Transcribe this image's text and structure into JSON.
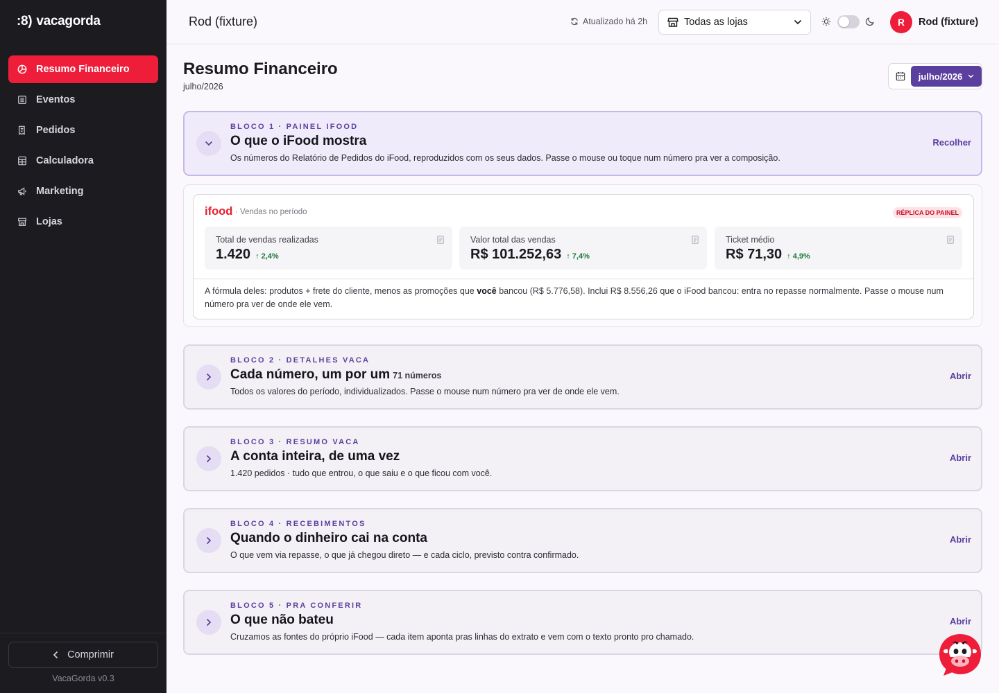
{
  "sidebar": {
    "logo_mark": ":8)",
    "logo_text": "vacagorda",
    "items": [
      {
        "label": "Resumo Financeiro",
        "icon": "pie-chart-icon",
        "active": true
      },
      {
        "label": "Eventos",
        "icon": "list-icon"
      },
      {
        "label": "Pedidos",
        "icon": "receipt-icon"
      },
      {
        "label": "Calculadora",
        "icon": "calculator-icon"
      },
      {
        "label": "Marketing",
        "icon": "megaphone-icon"
      },
      {
        "label": "Lojas",
        "icon": "store-icon"
      }
    ],
    "collapse_label": "Comprimir",
    "version": "VacaGorda v0.3"
  },
  "topbar": {
    "title": "Rod (fixture)",
    "updated": "Atualizado há 2h",
    "store_select": "Todas as lojas",
    "user_initial": "R",
    "user_name": "Rod (fixture)"
  },
  "page": {
    "title": "Resumo Financeiro",
    "subtitle": "julho/2026",
    "period": "julho/2026"
  },
  "blocks": [
    {
      "eyebrow": "BLOCO 1 · PAINEL IFOOD",
      "title": "O que o iFood mostra",
      "count": "",
      "desc": "Os números do Relatório de Pedidos do iFood, reproduzidos com os seus dados. Passe o mouse ou toque num número pra ver a composição.",
      "action": "Recolher"
    },
    {
      "eyebrow": "BLOCO 2 · DETALHES VACA",
      "title": "Cada número, um por um",
      "count": "71 números",
      "desc": "Todos os valores do período, individualizados. Passe o mouse num número pra ver de onde ele vem.",
      "action": "Abrir"
    },
    {
      "eyebrow": "BLOCO 3 · RESUMO VACA",
      "title": "A conta inteira, de uma vez",
      "count": "",
      "desc": "1.420 pedidos · tudo que entrou, o que saiu e o que ficou com você.",
      "action": "Abrir"
    },
    {
      "eyebrow": "BLOCO 4 · RECEBIMENTOS",
      "title": "Quando o dinheiro cai na conta",
      "count": "",
      "desc": "O que vem via repasse, o que já chegou direto — e cada ciclo, previsto contra confirmado.",
      "action": "Abrir"
    },
    {
      "eyebrow": "BLOCO 5 · PRA CONFERIR",
      "title": "O que não bateu",
      "count": "",
      "desc": "Cruzamos as fontes do próprio iFood — cada item aponta pras linhas do extrato e vem com o texto pronto pro chamado.",
      "action": "Abrir"
    }
  ],
  "ifood_panel": {
    "logo": "ifood",
    "subtitle": "· Vendas no período",
    "badge": "RÉPLICA DO PAINEL",
    "metrics": [
      {
        "label": "Total de vendas realizadas",
        "value": "1.420",
        "delta": "↑ 2,4%"
      },
      {
        "label": "Valor total das vendas",
        "value": "R$ 101.252,63",
        "delta": "↑ 7,4%"
      },
      {
        "label": "Ticket médio",
        "value": "R$ 71,30",
        "delta": "↑ 4,9%"
      }
    ],
    "note_pre": "A fórmula deles: produtos + frete do cliente, menos as promoções que ",
    "note_bold": "você",
    "note_post": " bancou (R$ 5.776,58). Inclui R$ 8.556,26 que o iFood bancou: entra no repasse normalmente. Passe o mouse num número pra ver de onde ele vem."
  },
  "colors": {
    "brand_red": "#ee1d3a",
    "accent_purple": "#5b3f9f",
    "sidebar_bg": "#1c1b20",
    "ifood_red": "#ea1d2c",
    "positive_green": "#1f7a3c"
  }
}
